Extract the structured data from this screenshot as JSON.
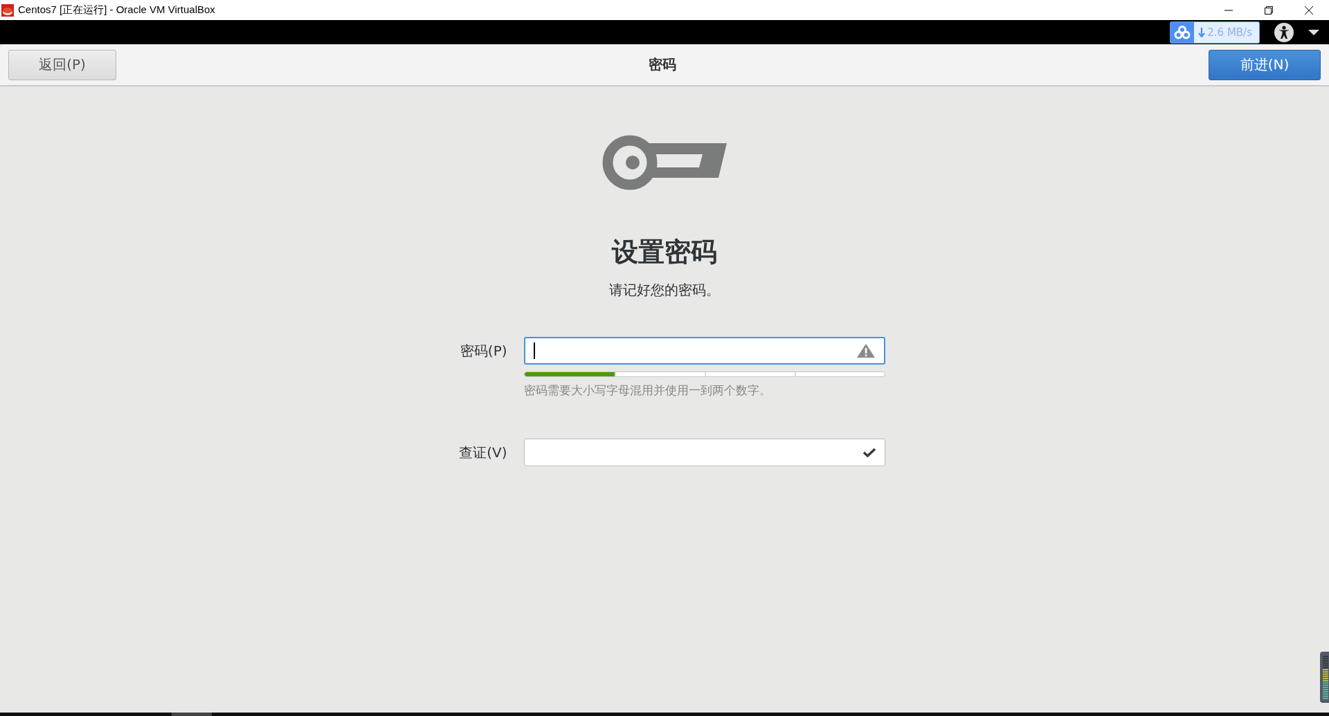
{
  "window": {
    "title": "Centos7 [正在运行] - Oracle VM VirtualBox"
  },
  "top_bar": {
    "download_speed": "2.6 MB/s"
  },
  "header": {
    "back_button": "返回(P)",
    "title": "密码",
    "next_button": "前进(N)"
  },
  "content": {
    "heading": "设置密码",
    "subtitle": "请记好您的密码。",
    "fields": [
      {
        "label": "密码(P)",
        "focused": true,
        "kind": "warning"
      },
      {
        "label": "查证(V)",
        "focused": false,
        "kind": "check"
      }
    ],
    "strength": {
      "level": 0.25
    },
    "hint": "密码需要大小写字母混用并使用一到两个数字。"
  }
}
